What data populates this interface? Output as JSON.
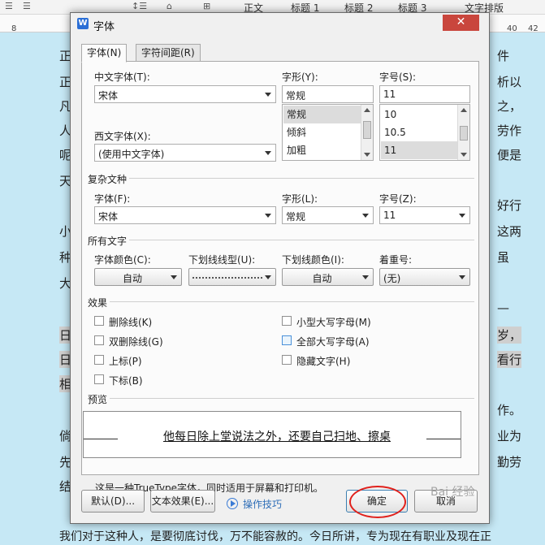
{
  "background": {
    "toolbar": {
      "items": [
        {
          "label": "正文"
        },
        {
          "label": "标题 1"
        },
        {
          "label": "标题 2"
        },
        {
          "label": "标题 3"
        },
        {
          "label": "文字排版"
        }
      ]
    },
    "ruler": {
      "left_number": "8",
      "right_numbers": [
        "40",
        "42"
      ]
    },
    "text_lines": [
      {
        "left": "正",
        "right": "件"
      },
      {
        "left": "正",
        "right": "析以"
      },
      {
        "left": "凡",
        "right": "之，"
      },
      {
        "left": "人",
        "right": "劳作"
      },
      {
        "left": "呢",
        "right": "便是"
      },
      {
        "left": "天",
        "right": ""
      },
      {
        "left": "",
        "right": "好行"
      },
      {
        "left": "小",
        "right": "这两"
      },
      {
        "left": "种",
        "right": "虽"
      },
      {
        "left": "大",
        "right": ""
      },
      {
        "left": "",
        "right": "—"
      },
      {
        "left": "日",
        "right": "岁，"
      },
      {
        "left": "日",
        "right": "看行"
      },
      {
        "left": "相",
        "right": ""
      },
      {
        "left": "",
        "right": "作。"
      },
      {
        "left": "倘",
        "right": "业为"
      },
      {
        "left": "先",
        "right": "勤劳"
      },
      {
        "left": "结",
        "right": ""
      }
    ],
    "bottom_line": "我们对于这种人，是要彻底讨伐，万不能容赦的。今日所讲，专为现在有职业及现在正"
  },
  "dialog": {
    "title": "字体",
    "close_label": "✕",
    "tabs": [
      {
        "label": "字体(N)"
      },
      {
        "label": "字符间距(R)"
      }
    ],
    "chinese_font": {
      "label": "中文字体(T):",
      "value": "宋体"
    },
    "western_font": {
      "label": "西文字体(X):",
      "value": "(使用中文字体)"
    },
    "font_style": {
      "label": "字形(Y):",
      "value": "常规",
      "options": [
        "常规",
        "倾斜",
        "加粗"
      ]
    },
    "font_size": {
      "label": "字号(S):",
      "value": "11",
      "options": [
        "10",
        "10.5",
        "11"
      ]
    },
    "complex_section": "复杂文种",
    "complex_font": {
      "label": "字体(F):",
      "value": "宋体"
    },
    "complex_style": {
      "label": "字形(L):",
      "value": "常规"
    },
    "complex_size": {
      "label": "字号(Z):",
      "value": "11"
    },
    "all_text_section": "所有文字",
    "font_color": {
      "label": "字体颜色(C):",
      "value": "自动"
    },
    "underline_type": {
      "label": "下划线线型(U):"
    },
    "underline_color": {
      "label": "下划线颜色(I):",
      "value": "自动"
    },
    "emphasis": {
      "label": "着重号:",
      "value": "(无)"
    },
    "effects_section": "效果",
    "effects": {
      "strikethrough": "删除线(K)",
      "double_strikethrough": "双删除线(G)",
      "superscript": "上标(P)",
      "subscript": "下标(B)",
      "small_caps": "小型大写字母(M)",
      "all_caps": "全部大写字母(A)",
      "hidden": "隐藏文字(H)"
    },
    "preview_section": "预览",
    "preview_text": "他每日除上堂说法之外，还要自己扫地、擦桌",
    "truetype_note": "这是一种TrueType字体，同时适用于屏幕和打印机。",
    "buttons": {
      "default": "默认(D)...",
      "text_effects": "文本效果(E)...",
      "tips": "操作技巧",
      "ok": "确定",
      "cancel": "取消"
    }
  },
  "watermark": "Bai 经验"
}
